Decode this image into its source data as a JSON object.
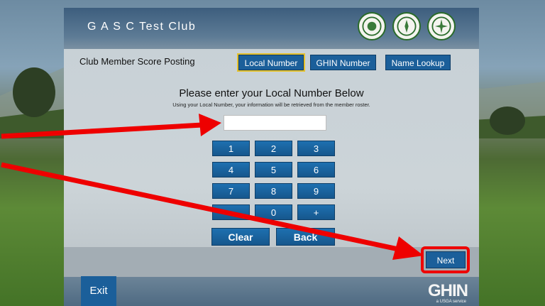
{
  "header": {
    "club_name": "G A S C Test Club",
    "seals": [
      "seal-icon-1",
      "seal-icon-2",
      "seal-icon-3"
    ]
  },
  "posting": {
    "title": "Club Member Score Posting",
    "tabs": [
      {
        "label": "Local Number",
        "active": true
      },
      {
        "label": "GHIN Number",
        "active": false
      },
      {
        "label": "Name Lookup",
        "active": false
      }
    ]
  },
  "entry": {
    "prompt": "Please enter your Local Number Below",
    "note": "Using your Local Number, your information will be retrieved from the member roster.",
    "value": ""
  },
  "keypad": {
    "keys": [
      "1",
      "2",
      "3",
      "4",
      "5",
      "6",
      "7",
      "8",
      "9",
      ".",
      "0",
      "+"
    ],
    "clear_label": "Clear",
    "back_label": "Back"
  },
  "nav": {
    "next_label": "Next",
    "exit_label": "Exit"
  },
  "brand": {
    "name": "GHIN",
    "tagline": "a USGA service"
  },
  "colors": {
    "button_blue": "#1b5f9a",
    "highlight_red": "#e00000",
    "active_outline": "#e4c12c"
  }
}
